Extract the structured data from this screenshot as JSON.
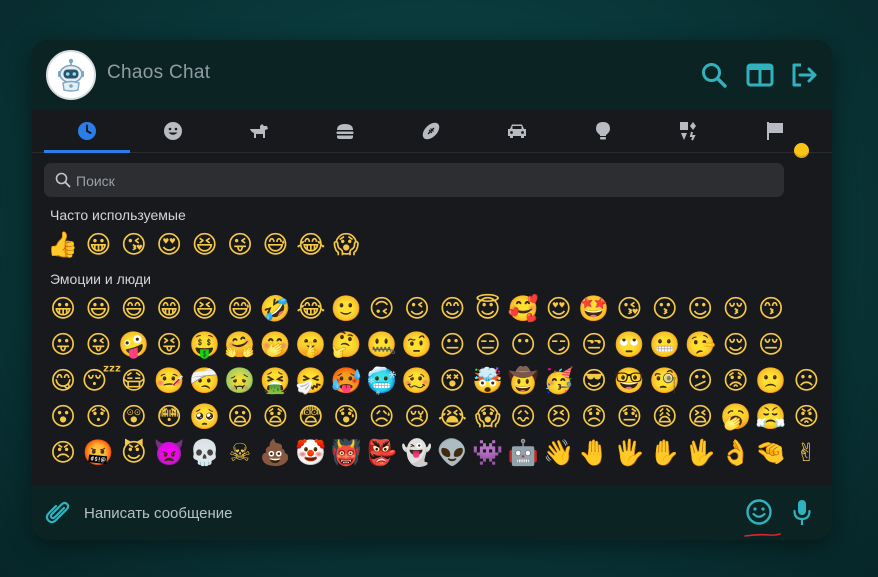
{
  "app": {
    "title": "Chaos Chat"
  },
  "header": {
    "icons": [
      "robot-avatar-icon",
      "search-icon",
      "split-view-icon",
      "logout-icon"
    ]
  },
  "picker": {
    "tabs": [
      {
        "name": "recent",
        "icon": "clock-icon",
        "active": true
      },
      {
        "name": "smileys",
        "icon": "smiley-icon",
        "active": false
      },
      {
        "name": "animals",
        "icon": "dog-icon",
        "active": false
      },
      {
        "name": "food",
        "icon": "burger-icon",
        "active": false
      },
      {
        "name": "activities",
        "icon": "football-icon",
        "active": false
      },
      {
        "name": "travel",
        "icon": "car-icon",
        "active": false
      },
      {
        "name": "objects",
        "icon": "lightbulb-icon",
        "active": false
      },
      {
        "name": "symbols",
        "icon": "symbols-icon",
        "active": false
      },
      {
        "name": "flags",
        "icon": "flag-icon",
        "active": false
      }
    ],
    "search": {
      "placeholder": "Поиск",
      "value": ""
    },
    "skin_tone_color": "#f8c416",
    "sections": [
      {
        "title": "Часто используемые",
        "rows": [
          [
            "👍",
            "😀",
            "😘",
            "😍",
            "😆",
            "😜",
            "😅",
            "😂",
            "😱"
          ]
        ]
      },
      {
        "title": "Эмоции и люди",
        "rows": [
          [
            "😀",
            "😃",
            "😄",
            "😁",
            "😆",
            "😅",
            "🤣",
            "😂",
            "🙂",
            "🙃",
            "😉",
            "😊",
            "😇",
            "🥰",
            "😍",
            "🤩",
            "😘",
            "😗",
            "☺",
            "😚",
            "😙"
          ],
          [
            "😛",
            "😜",
            "🤪",
            "😝",
            "🤑",
            "🤗",
            "🤭",
            "🤫",
            "🤔",
            "🤐",
            "🤨",
            "😐",
            "😑",
            "😶",
            "😏",
            "😒",
            "🙄",
            "😬",
            "🤥",
            "😌",
            "😔"
          ],
          [
            "😋",
            "😴",
            "😷",
            "🤒",
            "🤕",
            "🤢",
            "🤮",
            "🤧",
            "🥵",
            "🥶",
            "🥴",
            "😵",
            "🤯",
            "🤠",
            "🥳",
            "😎",
            "🤓",
            "🧐",
            "😕",
            "😟",
            "🙁",
            "☹"
          ],
          [
            "😮",
            "😯",
            "😲",
            "😳",
            "🥺",
            "😦",
            "😧",
            "😨",
            "😰",
            "😥",
            "😢",
            "😭",
            "😱",
            "😖",
            "😣",
            "😞",
            "😓",
            "😩",
            "😫",
            "🥱",
            "😤",
            "😡"
          ],
          [
            "😠",
            "🤬",
            "😈",
            "👿",
            "💀",
            "☠",
            "💩",
            "🤡",
            "👹",
            "👺",
            "👻",
            "👽",
            "👾",
            "🤖",
            "👋",
            "🤚",
            "🖐",
            "✋",
            "🖖",
            "👌",
            "🤏",
            "✌"
          ]
        ]
      }
    ]
  },
  "composer": {
    "placeholder": "Написать сообщение",
    "value": "",
    "accent_color": "#2fb2bd",
    "underline_color": "#d8262c"
  }
}
